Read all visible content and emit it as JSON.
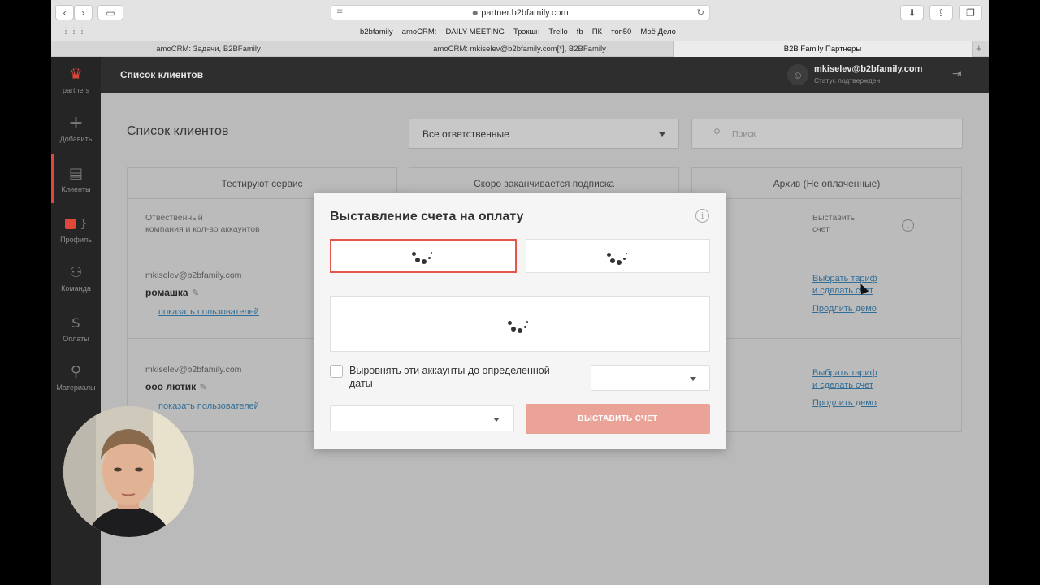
{
  "browser": {
    "url": "partner.b2bfamily.com",
    "bookmarks": [
      "b2bfamily",
      "amoCRM:",
      "DAILY MEETING",
      "Трэкшн",
      "Trello",
      "fb",
      "ПК",
      "топ50",
      "Моё Дело"
    ],
    "tabs": [
      "amoCRM: Задачи, B2BFamily",
      "amoCRM: mkiselev@b2bfamily.com[*], B2BFamily",
      "B2B Family Партнеры"
    ]
  },
  "sidebar": {
    "logo_label": "partners",
    "items": [
      {
        "label": "Добавить",
        "icon": "plus-icon"
      },
      {
        "label": "Клиенты",
        "icon": "document-icon"
      },
      {
        "label": "Профиль",
        "icon": "profile-icon"
      },
      {
        "label": "Команда",
        "icon": "team-icon"
      },
      {
        "label": "Оплаты",
        "icon": "dollar-icon"
      },
      {
        "label": "Материалы",
        "icon": "pin-icon"
      }
    ]
  },
  "header": {
    "title": "Список клиентов",
    "user_email": "mkiselev@b2bfamily.com",
    "user_status": "Статус подтвержден"
  },
  "main": {
    "page_title": "Список клиентов",
    "responsible_filter": "Все ответственные",
    "search_placeholder": "Поиск",
    "columns": [
      {
        "title": "Тестируют сервис",
        "sub_header": "Отвественный\nкомпания и кол-во аккаунтов"
      },
      {
        "title": "Скоро заканчивается подписка"
      },
      {
        "title": "Архив (Не оплаченные)",
        "sub_header": "Выставить\nсчет"
      }
    ],
    "clients": [
      {
        "email": "mkiselev@b2bfamily.com",
        "name": "ромашка",
        "users_link": "показать пользователей",
        "tariff_link_1": "Выбрать тариф",
        "tariff_link_2": "и сделать счет",
        "demo_link": "Продлить демо"
      },
      {
        "email": "mkiselev@b2bfamily.com",
        "name": "ооо лютик",
        "users_link": "показать пользователей",
        "tariff_link_1": "Выбрать тариф",
        "tariff_link_2": "и сделать счет",
        "demo_link": "Продлить демо"
      }
    ]
  },
  "modal": {
    "title": "Выставление счета на оплату",
    "align_checkbox_label": "Выровнять эти аккаунты до определенной даты",
    "align_checkbox_checked": false,
    "submit_label": "ВЫСТАВИТЬ СЧЕТ"
  }
}
